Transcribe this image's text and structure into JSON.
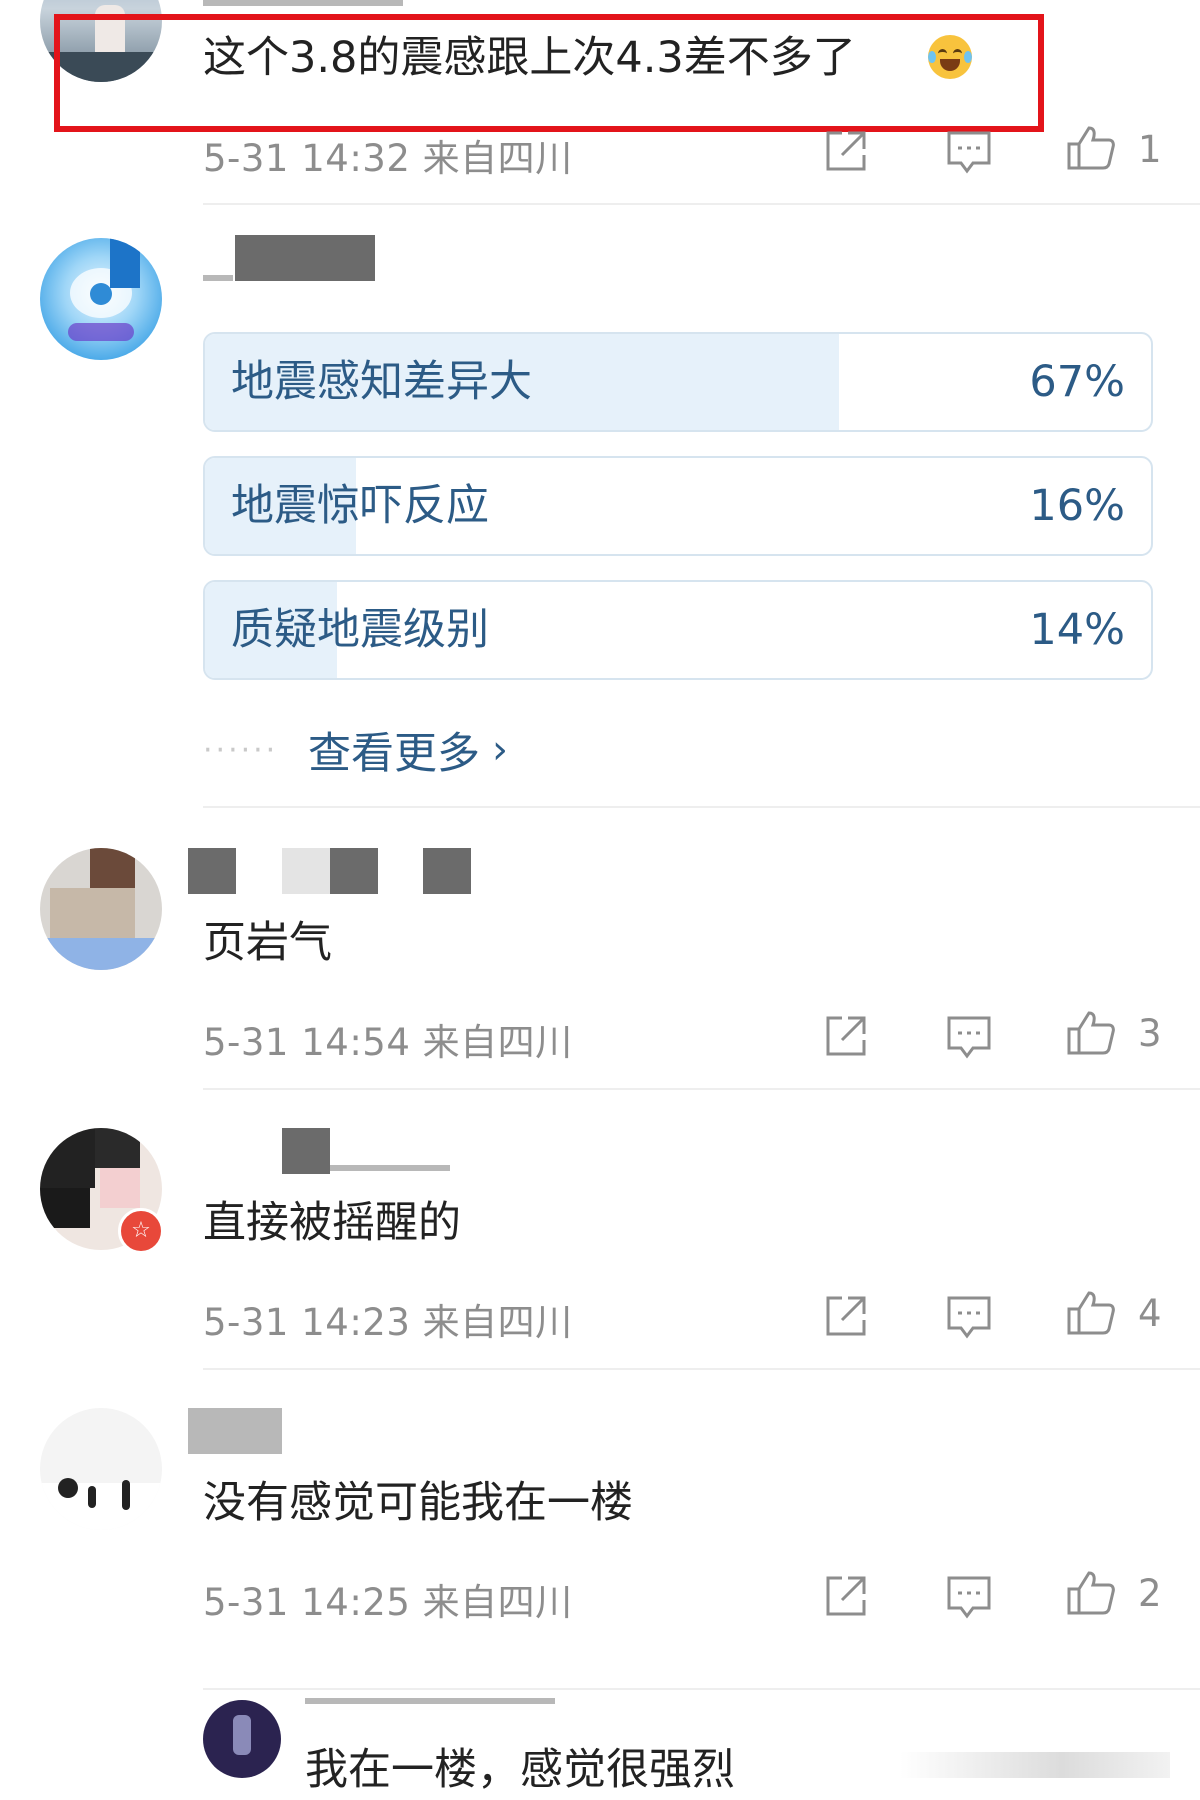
{
  "comments": [
    {
      "text": "这个3.8的震感跟上次4.3差不多了",
      "time": "5-31 14:32",
      "location": "来自四川",
      "likes": "1",
      "emoji_name": "laughing-crying-emoji"
    },
    {
      "text": "页岩气",
      "time": "5-31 14:54",
      "location": "来自四川",
      "likes": "3"
    },
    {
      "text": "直接被摇醒的",
      "time": "5-31 14:23",
      "location": "来自四川",
      "likes": "4"
    },
    {
      "text": "没有感觉可能我在一楼",
      "time": "5-31 14:25",
      "location": "来自四川",
      "likes": "2"
    },
    {
      "text": "我在一楼，感觉很强烈"
    }
  ],
  "poll": {
    "options": [
      {
        "label": "地震感知差异大",
        "percent": "67%",
        "fraction": 0.67
      },
      {
        "label": "地震惊吓反应",
        "percent": "16%",
        "fraction": 0.16
      },
      {
        "label": "质疑地震级别",
        "percent": "14%",
        "fraction": 0.14
      }
    ],
    "see_more": "查看更多",
    "see_more_dots": "······"
  },
  "colors": {
    "poll_text": "#2c5b86",
    "poll_fill": "#e6f1fa",
    "highlight_border": "#e3141a",
    "meta_text": "#8d8d8d"
  },
  "icons": {
    "share": "share-icon",
    "comment": "comment-icon",
    "like": "thumbs-up-icon"
  }
}
